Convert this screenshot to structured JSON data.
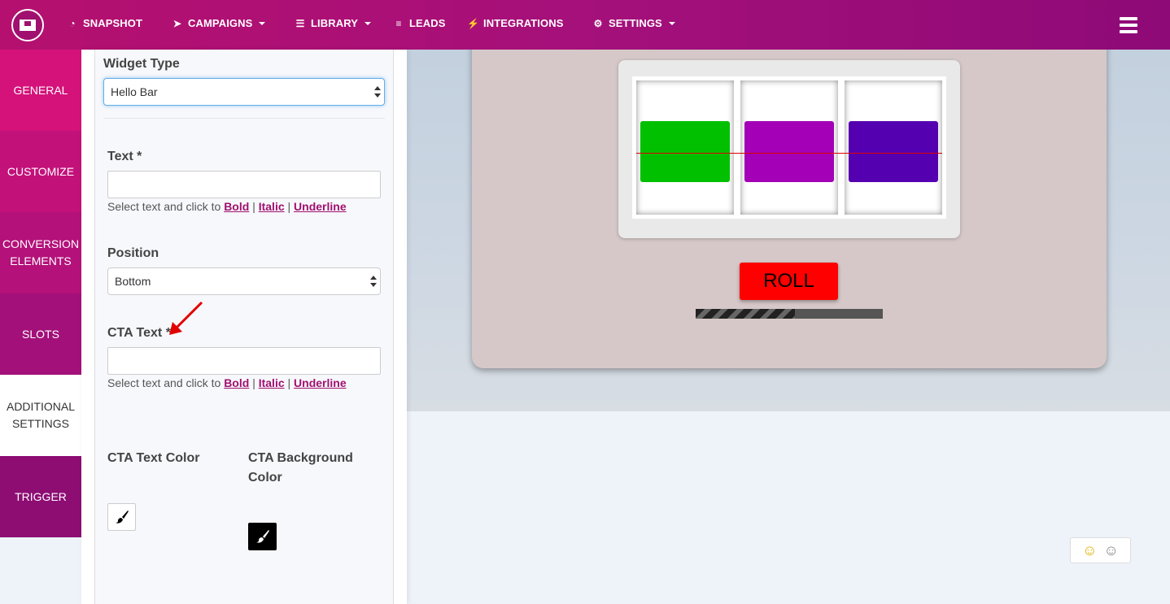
{
  "nav": {
    "items": [
      {
        "label": "SNAPSHOT",
        "icon": "dashboard-icon",
        "dropdown": false
      },
      {
        "label": "CAMPAIGNS",
        "icon": "paper-plane-icon",
        "dropdown": true
      },
      {
        "label": "LIBRARY",
        "icon": "stack-icon",
        "dropdown": true
      },
      {
        "label": "LEADS",
        "icon": "list-icon",
        "dropdown": false
      },
      {
        "label": "INTEGRATIONS",
        "icon": "plug-icon",
        "dropdown": false
      },
      {
        "label": "SETTINGS",
        "icon": "gears-icon",
        "dropdown": true
      }
    ],
    "menu_icon": "hamburger-icon"
  },
  "sidebar": {
    "items": [
      {
        "label": "GENERAL"
      },
      {
        "label": "CUSTOMIZE"
      },
      {
        "label": "CONVERSION ELEMENTS"
      },
      {
        "label": "SLOTS"
      },
      {
        "label": "ADDITIONAL SETTINGS",
        "active": true
      },
      {
        "label": "TRIGGER"
      }
    ]
  },
  "form": {
    "widget_type_label": "Widget Type",
    "widget_type_value": "Hello Bar",
    "text_label": "Text *",
    "text_value": "",
    "help_prefix": "Select text and click to",
    "bold": "Bold",
    "italic": "Italic",
    "underline": "Underline",
    "sep": "|",
    "position_label": "Position",
    "position_value": "Bottom",
    "cta_text_label": "CTA Text *",
    "cta_text_value": "",
    "cta_text_color_label": "CTA Text Color",
    "cta_bg_color_label": "CTA Background Color",
    "cta_text_color": "#ffffff",
    "cta_bg_color": "#000000"
  },
  "preview": {
    "roll_label": "ROLL",
    "reel_colors": [
      "#00c000",
      "#a300b8",
      "#5500b0"
    ],
    "progress_fraction": 0.53
  },
  "colors": {
    "brand": "#a0106f",
    "annotation_arrow": "#e00000"
  }
}
